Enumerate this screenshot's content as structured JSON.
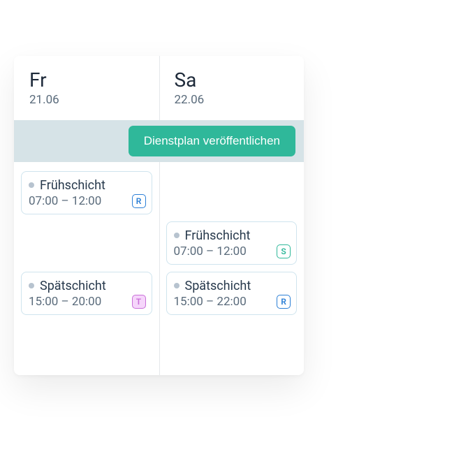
{
  "days": [
    {
      "abbrev": "Fr",
      "date": "21.06"
    },
    {
      "abbrev": "Sa",
      "date": "22.06"
    }
  ],
  "publish_label": "Dienstplan veröffentlichen",
  "shifts": {
    "fr": [
      {
        "title": "Frühschicht",
        "time": "07:00 – 12:00",
        "badge": "R"
      },
      {
        "title": "Spätschicht",
        "time": "15:00 – 20:00",
        "badge": "T"
      }
    ],
    "sa": [
      {
        "title": "Frühschicht",
        "time": "07:00 – 12:00",
        "badge": "S"
      },
      {
        "title": "Spätschicht",
        "time": "15:00 – 22:00",
        "badge": "R"
      }
    ]
  }
}
